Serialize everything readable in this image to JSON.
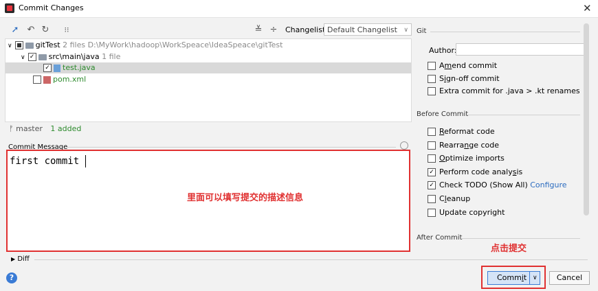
{
  "window": {
    "title": "Commit Changes",
    "close_glyph": "✕"
  },
  "toolbar": {
    "icons": [
      "move-icon",
      "undo-icon",
      "refresh-icon",
      "group-icon",
      "expand-all-icon",
      "collapse-all-icon"
    ],
    "changelist_label": "Changelist:",
    "changelist_value": "Default Changelist"
  },
  "tree": {
    "root": {
      "name": "gitTest",
      "info": "2 files  D:\\MyWork\\hadoop\\WorkSpeace\\IdeaSpeace\\gitTest"
    },
    "folder": {
      "name": "src\\main\\java",
      "info": "1 file"
    },
    "file1": {
      "name": "test.java"
    },
    "file2": {
      "name": "pom.xml"
    }
  },
  "status": {
    "branch": "master",
    "added": "1 added"
  },
  "message": {
    "label": "Commit Message",
    "text": "first commit",
    "annotation": "里面可以填写提交的描述信息"
  },
  "diff_label": "Diff",
  "git": {
    "section": "Git",
    "author_label": "Author:",
    "author_value": "",
    "amend_pre": "A",
    "amend_u": "m",
    "amend_post": "end commit",
    "signoff_pre": "S",
    "signoff_u": "i",
    "signoff_post": "gn-off commit",
    "extra": "Extra commit for .java > .kt renames"
  },
  "before_commit": {
    "section": "Before Commit",
    "reformat_u": "R",
    "reformat_post": "eformat code",
    "rearrange_pre": "Rearra",
    "rearrange_u": "n",
    "rearrange_post": "ge code",
    "optimize_u": "O",
    "optimize_post": "ptimize imports",
    "analysis_pre": "Perform code analy",
    "analysis_u": "s",
    "analysis_post": "is",
    "todo": "Check TODO (Show All)",
    "configure": "Configure",
    "cleanup_pre": "C",
    "cleanup_u": "l",
    "cleanup_post": "eanup",
    "copyright": "Update copyright"
  },
  "after_commit": {
    "section": "After Commit"
  },
  "buttons": {
    "commit_pre": "Comm",
    "commit_u": "i",
    "commit_post": "t",
    "commit_arrow": "∨",
    "cancel": "Cancel",
    "annotation": "点击提交"
  },
  "colors": {
    "accent": "#3a7bd5",
    "annotation": "#e03030",
    "added": "#2d8a2d"
  }
}
